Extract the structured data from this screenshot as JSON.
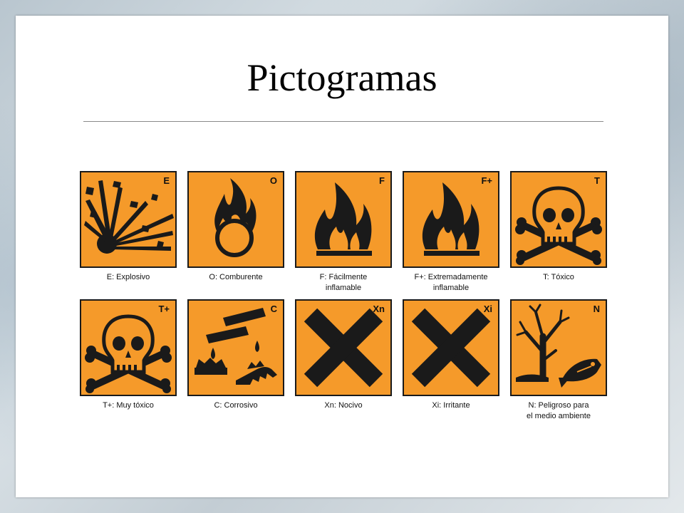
{
  "slide": {
    "title": "Pictogramas"
  },
  "pictograms": [
    {
      "code": "E",
      "icon": "explosion-icon",
      "label_line1": "E: Explosivo",
      "label_line2": ""
    },
    {
      "code": "O",
      "icon": "flame-over-circle-icon",
      "label_line1": "O: Comburente",
      "label_line2": ""
    },
    {
      "code": "F",
      "icon": "flame-icon",
      "label_line1": "F: Fácilmente",
      "label_line2": "inflamable"
    },
    {
      "code": "F+",
      "icon": "flame-icon",
      "label_line1": "F+: Extremadamente",
      "label_line2": "inflamable"
    },
    {
      "code": "T",
      "icon": "skull-crossbones-icon",
      "label_line1": "T: Tóxico",
      "label_line2": ""
    },
    {
      "code": "T+",
      "icon": "skull-crossbones-icon",
      "label_line1": "T+: Muy tóxico",
      "label_line2": ""
    },
    {
      "code": "C",
      "icon": "corrosion-icon",
      "label_line1": "C: Corrosivo",
      "label_line2": ""
    },
    {
      "code": "Xn",
      "icon": "saint-andrew-cross-icon",
      "label_line1": "Xn: Nocivo",
      "label_line2": ""
    },
    {
      "code": "Xi",
      "icon": "saint-andrew-cross-icon",
      "label_line1": "Xi: Irritante",
      "label_line2": ""
    },
    {
      "code": "N",
      "icon": "dead-tree-fish-icon",
      "label_line1": "N: Peligroso para",
      "label_line2": "el medio ambiente"
    }
  ],
  "colors": {
    "pictogram_background": "#f59a2a",
    "symbol": "#1a1a1a"
  }
}
